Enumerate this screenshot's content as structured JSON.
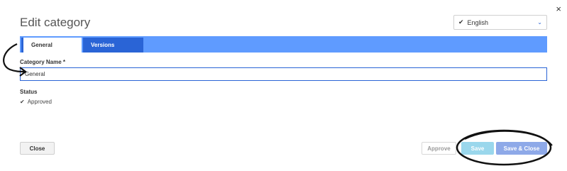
{
  "dialog": {
    "title": "Edit category",
    "close_glyph": "×"
  },
  "language": {
    "check_glyph": "✔",
    "value": "English",
    "chevron_glyph": "⌄"
  },
  "tabs": [
    {
      "label": "General"
    },
    {
      "label": "Versions"
    }
  ],
  "form": {
    "category_name_label": "Category Name *",
    "category_name_value": "General",
    "status_label": "Status",
    "status_check": "✔",
    "status_value": "Approved"
  },
  "footer": {
    "close_label": "Close",
    "approve_label": "Approve",
    "save_label": "Save",
    "save_close_label": "Save & Close"
  },
  "colors": {
    "accent": "#2a64d6",
    "tabbar": "#5f9bff",
    "save": "#9ad7ec",
    "save_close": "#8ea9e8"
  },
  "icons": [
    "close-icon",
    "check-icon",
    "chevron-down-icon"
  ]
}
